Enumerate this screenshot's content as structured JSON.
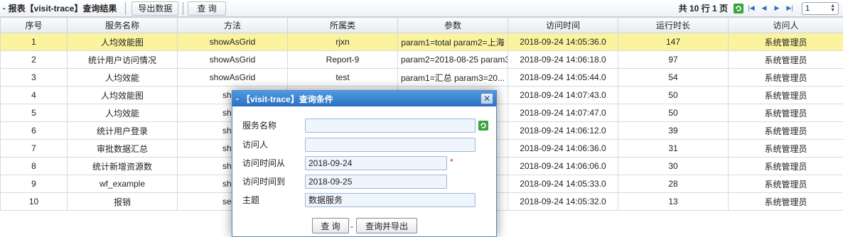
{
  "toolbar": {
    "title_prefix": "-",
    "title": "报表【visit-trace】查询结果",
    "export_label": "导出数据",
    "query_label": "查 询",
    "pager_text": "共 10 行 1 页",
    "page_select_value": "1"
  },
  "table": {
    "columns": [
      "序号",
      "服务名称",
      "方法",
      "所属类",
      "参数",
      "访问时间",
      "运行时长",
      "访问人"
    ],
    "rows": [
      [
        "1",
        "人均效能图",
        "showAsGrid",
        "rjxn",
        "param1=total param2=上海",
        "2018-09-24 14:05:36.0",
        "147",
        "系统管理员"
      ],
      [
        "2",
        "统计用户访问情况",
        "showAsGrid",
        "Report-9",
        "param2=2018-08-25 param3",
        "2018-09-24 14:06:18.0",
        "97",
        "系统管理员"
      ],
      [
        "3",
        "人均效能",
        "showAsGrid",
        "test",
        "param1=汇总 param3=20...",
        "2018-09-24 14:05:44.0",
        "54",
        "系统管理员"
      ],
      [
        "4",
        "人均效能图",
        "show",
        "",
        "",
        "2018-09-24 14:07:43.0",
        "50",
        "系统管理员"
      ],
      [
        "5",
        "人均效能",
        "show",
        "",
        "",
        "2018-09-24 14:07:47.0",
        "50",
        "系统管理员"
      ],
      [
        "6",
        "统计用户登录",
        "show",
        "",
        "",
        "2018-09-24 14:06:12.0",
        "39",
        "系统管理员"
      ],
      [
        "7",
        "审批数据汇总",
        "show",
        "",
        "s",
        "2018-09-24 14:06:36.0",
        "31",
        "系统管理员"
      ],
      [
        "8",
        "统计新增资源数",
        "show",
        "",
        "",
        "2018-09-24 14:06:06.0",
        "30",
        "系统管理员"
      ],
      [
        "9",
        "wf_example",
        "show",
        "",
        "",
        "2018-09-24 14:05:33.0",
        "28",
        "系统管理员"
      ],
      [
        "10",
        "报销",
        "selec",
        "",
        "",
        "2018-09-24 14:05:32.0",
        "13",
        "系统管理员"
      ]
    ],
    "selected_row": 0
  },
  "modal": {
    "title_prefix": "-",
    "title": "【visit-trace】查询条件",
    "fields": [
      {
        "label": "服务名称",
        "value": "",
        "placeholder": ""
      },
      {
        "label": "访问人",
        "value": "",
        "placeholder": ""
      },
      {
        "label": "访问时间从",
        "value": "2018-09-24",
        "required_mark": "*"
      },
      {
        "label": "访问时间到",
        "value": "2018-09-25"
      },
      {
        "label": "主题",
        "value": "数据服务"
      }
    ],
    "query_button": "查 询",
    "separator": "-",
    "query_export_button": "查询并导出"
  },
  "colors": {
    "selected_row": "#fbf39e",
    "modal_header": "#2a6fc0",
    "input_bg": "#eef5fd",
    "required": "#d02020"
  },
  "icons": [
    "close-icon",
    "refresh-icon",
    "first-page-icon",
    "prev-page-icon",
    "next-page-icon",
    "last-page-icon"
  ]
}
